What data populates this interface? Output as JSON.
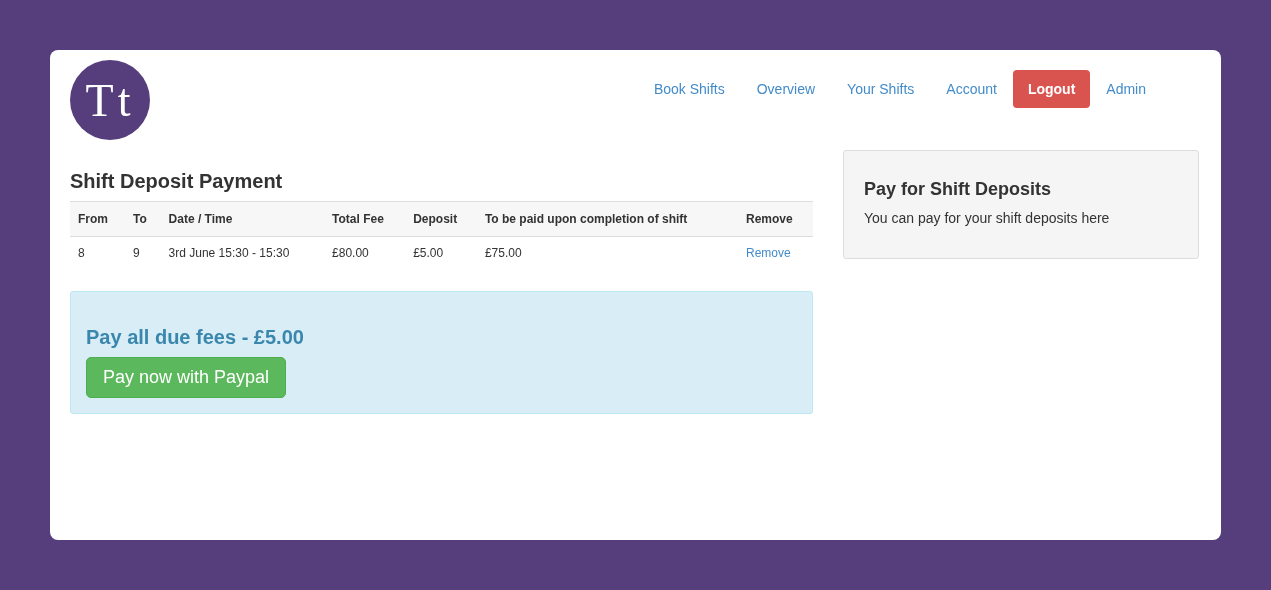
{
  "logo": {
    "text": "Tt"
  },
  "nav": [
    {
      "label": "Book Shifts",
      "kind": "link"
    },
    {
      "label": "Overview",
      "kind": "link"
    },
    {
      "label": "Your Shifts",
      "kind": "link"
    },
    {
      "label": "Account",
      "kind": "link"
    },
    {
      "label": "Logout",
      "kind": "button"
    },
    {
      "label": "Admin",
      "kind": "link"
    }
  ],
  "page_title": "Shift Deposit Payment",
  "table": {
    "columns": [
      "From",
      "To",
      "Date / Time",
      "Total Fee",
      "Deposit",
      "To be paid upon completion of shift",
      "Remove"
    ],
    "rows": [
      [
        "8",
        "9",
        "3rd June 15:30 - 15:30",
        "£80.00",
        "£5.00",
        "£75.00",
        "Remove"
      ]
    ]
  },
  "payment": {
    "heading": "Pay all due fees - £5.00",
    "button": "Pay now with Paypal"
  },
  "side_panel": {
    "title": "Pay for Shift Deposits",
    "text": "You can pay for your shift deposits here"
  }
}
